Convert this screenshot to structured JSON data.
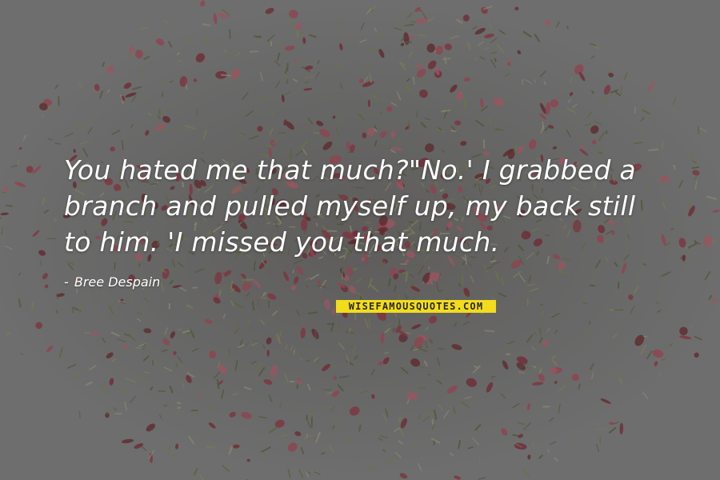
{
  "quote": {
    "lines": [
      "You hated me that much?\"No.' I grabbed a",
      "branch and pulled myself up, my back still",
      "to him. 'I missed you that much."
    ]
  },
  "author": {
    "dash": "-",
    "name": "Bree Despain"
  },
  "brand": {
    "logo_text": "WISEFAMOUSQUOTES.COM"
  },
  "colors": {
    "background": "#6e6e6e",
    "text": "#ffffff",
    "brand_bg": "#f2dc1c",
    "petal": "#8a3a44",
    "herb": "#5f6a3c"
  }
}
